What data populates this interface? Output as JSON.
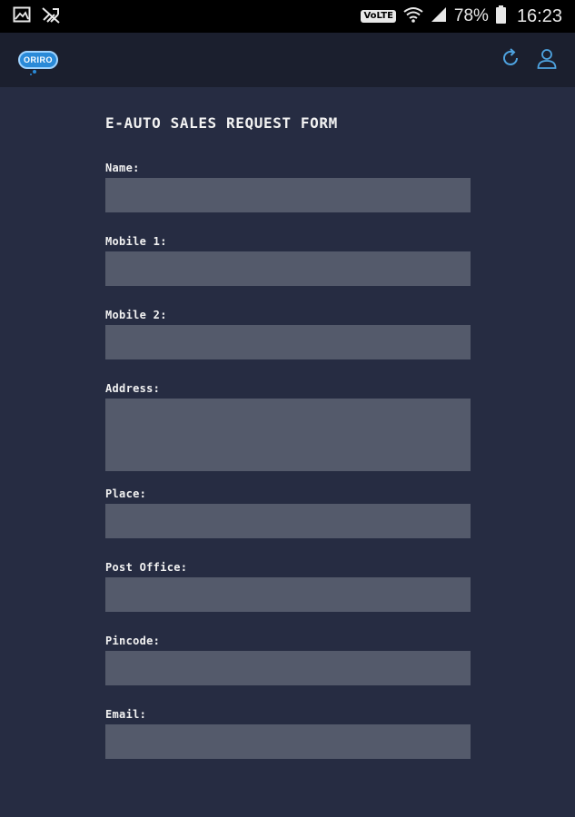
{
  "status_bar": {
    "left_icons": [
      "gallery-icon",
      "no-signal-icon"
    ],
    "volte": "VoLTE",
    "battery_percent": "78%",
    "time": "16:23"
  },
  "app_bar": {
    "logo_text": "ORIRO",
    "actions": [
      "refresh-icon",
      "user-icon"
    ],
    "accent_color": "#4ea3e0"
  },
  "form": {
    "title": "E-AUTO SALES REQUEST FORM",
    "fields": {
      "name": {
        "label": "Name:",
        "value": ""
      },
      "mobile1": {
        "label": "Mobile 1:",
        "value": ""
      },
      "mobile2": {
        "label": "Mobile 2:",
        "value": ""
      },
      "address": {
        "label": "Address:",
        "value": ""
      },
      "place": {
        "label": "Place:",
        "value": ""
      },
      "post_office": {
        "label": "Post Office:",
        "value": ""
      },
      "pincode": {
        "label": "Pincode:",
        "value": ""
      },
      "email": {
        "label": "Email:",
        "value": ""
      }
    }
  }
}
